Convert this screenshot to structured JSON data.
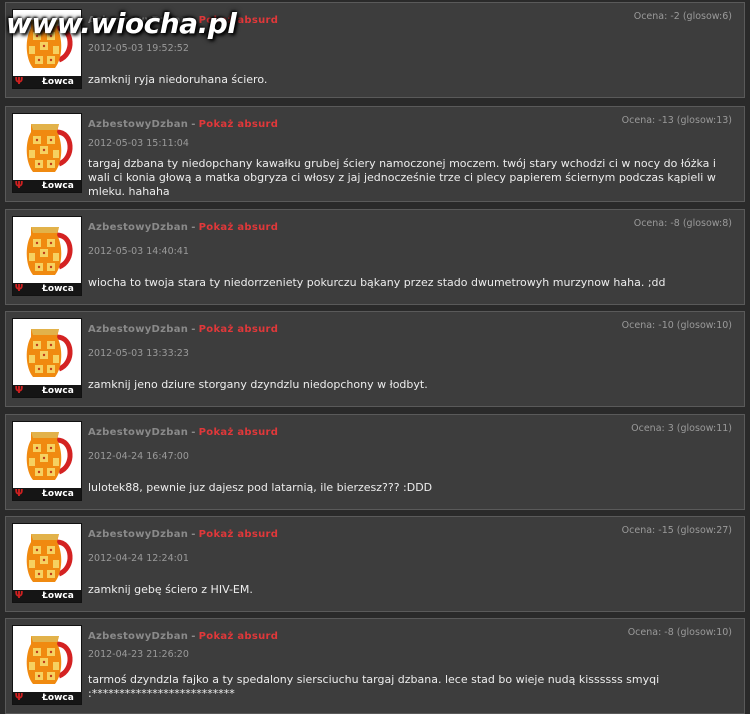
{
  "site": {
    "logo": "www.wiocha.pl"
  },
  "common": {
    "absurd_label": "Pokaż absurd",
    "rank": "Łowca",
    "dash": "-"
  },
  "comments": [
    {
      "username": "AzbestowyDzban",
      "date": "2012-05-03 19:52:52",
      "score": "Ocena: -2 (glosow:6)",
      "text": "zamknij ryja niedoruhana ściero."
    },
    {
      "username": "AzbestowyDzban",
      "date": "2012-05-03 15:11:04",
      "score": "Ocena: -13 (glosow:13)",
      "text": "targaj dzbana ty niedopchany kawałku grubej ściery namoczonej moczem. twój stary wchodzi ci w nocy do łóżka i wali ci konia głową a matka obgryza ci włosy z jaj jednocześnie trze ci plecy papierem ściernym podczas kąpieli w mleku. hahaha"
    },
    {
      "username": "AzbestowyDzban",
      "date": "2012-05-03 14:40:41",
      "score": "Ocena: -8 (glosow:8)",
      "text": "wiocha to twoja stara ty niedorrzeniety pokurczu bąkany przez stado dwumetrowyh murzynow haha. ;dd"
    },
    {
      "username": "AzbestowyDzban",
      "date": "2012-05-03 13:33:23",
      "score": "Ocena: -10 (glosow:10)",
      "text": "zamknij jeno dziure storgany dzyndzlu niedopchony w łodbyt."
    },
    {
      "username": "AzbestowyDzban",
      "date": "2012-04-24 16:47:00",
      "score": "Ocena: 3 (glosow:11)",
      "text": "lulotek88, pewnie juz dajesz pod latarnią, ile bierzesz??? :DDD"
    },
    {
      "username": "AzbestowyDzban",
      "date": "2012-04-24 12:24:01",
      "score": "Ocena: -15 (glosow:27)",
      "text": "zamknij gebę ściero z HIV-EM."
    },
    {
      "username": "AzbestowyDzban",
      "date": "2012-04-23 21:26:20",
      "score": "Ocena: -8 (glosow:10)",
      "text": "tarmoś dzyndzla fajko a ty spedalony siersciuchu targaj dzbana. lece stad bo wieje nudą kissssss smyqi :**************************"
    }
  ],
  "colors": {
    "background": "#2a2a2a",
    "panel": "#3d3d3d",
    "absurd": "#e0383a",
    "username": "#8a8a8a"
  }
}
